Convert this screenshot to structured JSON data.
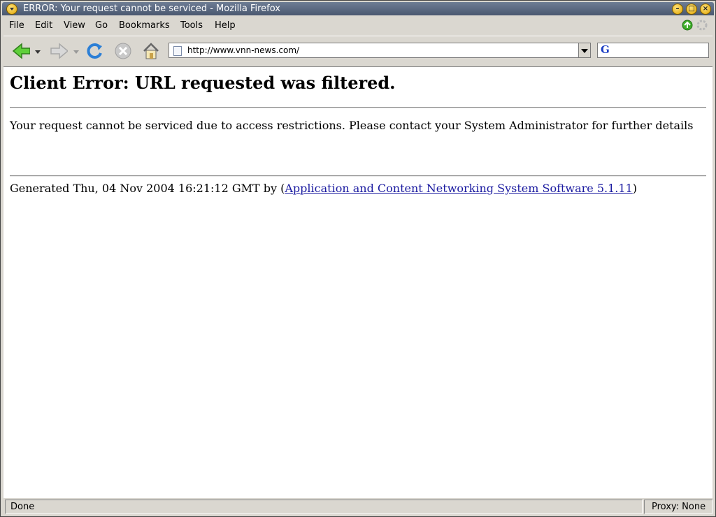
{
  "window": {
    "title": "ERROR: Your request cannot be serviced - Mozilla Firefox"
  },
  "menu": {
    "file": "File",
    "edit": "Edit",
    "view": "View",
    "go": "Go",
    "bookmarks": "Bookmarks",
    "tools": "Tools",
    "help": "Help"
  },
  "toolbar": {
    "icons": [
      "back-icon",
      "forward-icon",
      "reload-icon",
      "stop-icon",
      "home-icon"
    ],
    "url": "http://www.vnn-news.com/",
    "search_value": ""
  },
  "page": {
    "heading": "Client Error: URL requested was filtered.",
    "message": "Your request cannot be serviced due to access restrictions. Please contact your System Administrator for further details",
    "generated_prefix": "Generated Thu, 04 Nov 2004 16:21:12 GMT by (",
    "generated_link": "Application and Content Networking System Software 5.1.11",
    "generated_suffix": ")"
  },
  "status": {
    "left": "Done",
    "right": "Proxy: None"
  },
  "colors": {
    "titlebar": "#4a5870",
    "link": "#1a1aa0",
    "accent_green": "#3fae2a"
  }
}
